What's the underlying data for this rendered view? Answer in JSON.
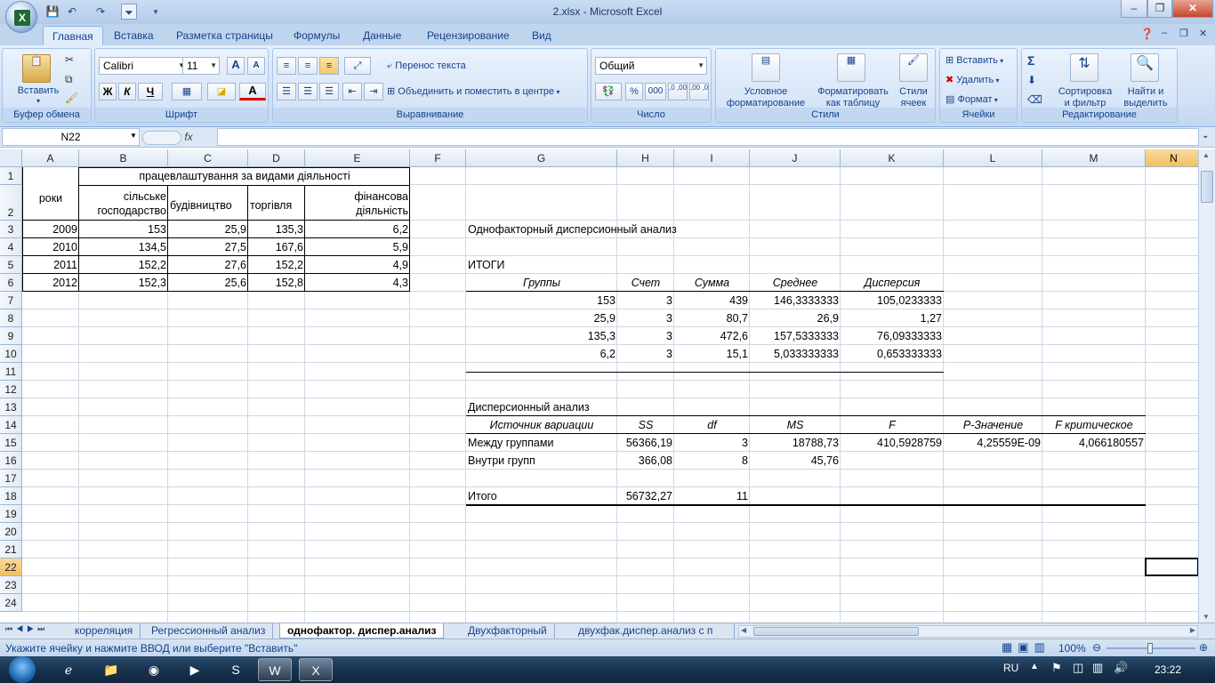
{
  "window": {
    "title": "2.xlsx - Microsoft Excel",
    "minimize": "–",
    "maximize": "❐",
    "close": "✕"
  },
  "ribbon": {
    "tabs": [
      "Главная",
      "Вставка",
      "Разметка страницы",
      "Формулы",
      "Данные",
      "Рецензирование",
      "Вид"
    ],
    "active_tab": "Главная",
    "groups": {
      "clipboard": {
        "label": "Буфер обмена",
        "paste": "Вставить"
      },
      "font": {
        "label": "Шрифт",
        "font_name": "Calibri",
        "font_size": "11",
        "bold": "Ж",
        "italic": "К",
        "underline": "Ч",
        "grow": "A",
        "shrink": "A",
        "font_color": "A"
      },
      "alignment": {
        "label": "Выравнивание",
        "wrap": "Перенос текста",
        "merge": "Объединить и поместить в центре"
      },
      "number": {
        "label": "Число",
        "format": "Общий",
        "percent": "%",
        "thousands": "000",
        "inc_decimal": ",0 ,00",
        "dec_decimal": ",00 ,0"
      },
      "styles": {
        "label": "Стили",
        "conditional": [
          "Условное",
          "форматирование"
        ],
        "table": [
          "Форматировать",
          "как таблицу"
        ],
        "cell_styles": [
          "Стили",
          "ячеек"
        ]
      },
      "cells": {
        "label": "Ячейки",
        "insert": "Вставить",
        "delete": "Удалить",
        "format": "Формат"
      },
      "editing": {
        "label": "Редактирование",
        "sum": "Σ",
        "sort": [
          "Сортировка",
          "и фильтр"
        ],
        "find": [
          "Найти и",
          "выделить"
        ]
      }
    }
  },
  "formula_bar": {
    "name_box": "N22",
    "fx": "fx",
    "value": ""
  },
  "grid": {
    "columns": [
      "A",
      "B",
      "C",
      "D",
      "E",
      "F",
      "G",
      "H",
      "I",
      "J",
      "K",
      "L",
      "M",
      "N"
    ],
    "selected_column": "N",
    "rows": [
      "1",
      "2",
      "3",
      "4",
      "5",
      "6",
      "7",
      "8",
      "9",
      "10",
      "11",
      "12",
      "13",
      "14",
      "15",
      "16",
      "17",
      "18",
      "19",
      "20",
      "21",
      "22",
      "23",
      "24"
    ],
    "selected_row": "22",
    "left_table": {
      "header_years": "роки",
      "header_group": "працевлаштування за видами діяльності",
      "subheaders": [
        [
          "сільське",
          "господарство"
        ],
        [
          "будівництво"
        ],
        [
          "торгівля"
        ],
        [
          "фінансова",
          "діяльність"
        ]
      ],
      "rows": [
        [
          "2009",
          "153",
          "25,9",
          "135,3",
          "6,2"
        ],
        [
          "2010",
          "134,5",
          "27,5",
          "167,6",
          "5,9"
        ],
        [
          "2011",
          "152,2",
          "27,6",
          "152,2",
          "4,9"
        ],
        [
          "2012",
          "152,3",
          "25,6",
          "152,8",
          "4,3"
        ]
      ]
    },
    "anova": {
      "title": "Однофакторный дисперсионный анализ",
      "summary_label": "ИТОГИ",
      "summary_headers": [
        "Группы",
        "Счет",
        "Сумма",
        "Среднее",
        "Дисперсия"
      ],
      "summary_rows": [
        [
          "153",
          "3",
          "439",
          "146,3333333",
          "105,0233333"
        ],
        [
          "25,9",
          "3",
          "80,7",
          "26,9",
          "1,27"
        ],
        [
          "135,3",
          "3",
          "472,6",
          "157,5333333",
          "76,09333333"
        ],
        [
          "6,2",
          "3",
          "15,1",
          "5,033333333",
          "0,653333333"
        ]
      ],
      "anova_label": "Дисперсионный анализ",
      "anova_headers": [
        "Источник вариации",
        "SS",
        "df",
        "MS",
        "F",
        "P-Значение",
        "F критическое"
      ],
      "between": [
        "Между группами",
        "56366,19",
        "3",
        "18788,73",
        "410,5928759",
        "4,25559E-09",
        "4,066180557"
      ],
      "within": [
        "Внутри групп",
        "366,08",
        "8",
        "45,76"
      ],
      "total": [
        "Итого",
        "56732,27",
        "11"
      ]
    }
  },
  "sheets": {
    "tabs": [
      "корреляция",
      "Регрессионный анализ",
      "однофактор. диспер.анализ",
      "Двухфакторный",
      "двухфак.диспер.анализ с п"
    ],
    "active": "однофактор. диспер.анализ"
  },
  "status": {
    "message": "Укажите ячейку и нажмите ВВОД или выберите \"Вставить\"",
    "zoom": "100%"
  },
  "taskbar": {
    "language": "RU",
    "time": "23:22"
  }
}
